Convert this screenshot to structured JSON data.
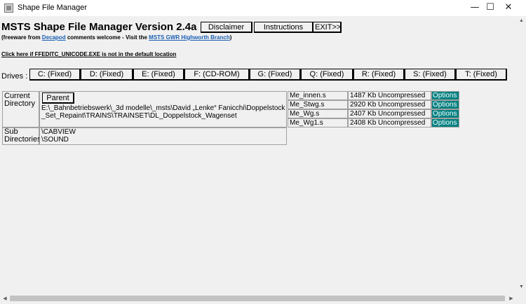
{
  "window": {
    "title": "Shape File Manager",
    "minimize_glyph": "—",
    "maximize_glyph": "☐",
    "close_glyph": "✕"
  },
  "header": {
    "app_title": "MSTS Shape File Manager Version 2.4a",
    "disclaimer_label": "Disclaimer",
    "instructions_label": "Instructions",
    "exit_label": "EXIT>>"
  },
  "info": {
    "freeware_prefix": "(freeware from ",
    "decapod_link": "Decapod",
    "freeware_middle": " comments welcome - Visit the ",
    "gwr_link": "MSTS GWR Highworth Branch",
    "freeware_suffix": ")",
    "locate_link": "Click here if FFEDITC_UNICODE.EXE is not in the default location"
  },
  "drives": {
    "label": "Drives :",
    "items": [
      {
        "label": "C: (Fixed)"
      },
      {
        "label": "D: (Fixed)"
      },
      {
        "label": "E: (Fixed)"
      },
      {
        "label": "F: (CD-ROM)"
      },
      {
        "label": "G: (Fixed)"
      },
      {
        "label": "Q: (Fixed)"
      },
      {
        "label": "R: (Fixed)"
      },
      {
        "label": "S: (Fixed)"
      },
      {
        "label": "T: (Fixed)"
      }
    ]
  },
  "directory": {
    "current_label": "Current Directory",
    "parent_label": "Parent",
    "current_path": "E:\\_Bahnbetriebswerk\\_3d modelle\\_msts\\David „Lenke“ Fanicchi\\Doppelstock_Set_Repaint\\TRAINS\\TRAINSET\\DL_Doppelstock_Wagenset",
    "sub_label": "Sub Directories",
    "subdirs": [
      "\\CABVIEW",
      "\\SOUND"
    ]
  },
  "files": [
    {
      "name": "Me_innen.s",
      "size": "1487 Kb Uncompressed",
      "option": "Options"
    },
    {
      "name": "Me_Stwg.s",
      "size": "2920 Kb Uncompressed",
      "option": "Options"
    },
    {
      "name": "Me_Wg.s",
      "size": "2407 Kb Uncompressed",
      "option": "Options"
    },
    {
      "name": "Me_Wg1.s",
      "size": "2408 Kb Uncompressed",
      "option": "Options"
    }
  ],
  "scroll": {
    "up": "▲",
    "down": "▼",
    "left": "◀",
    "right": "▶"
  },
  "colors": {
    "options_bg": "#008080",
    "link": "#1a5fb4"
  }
}
